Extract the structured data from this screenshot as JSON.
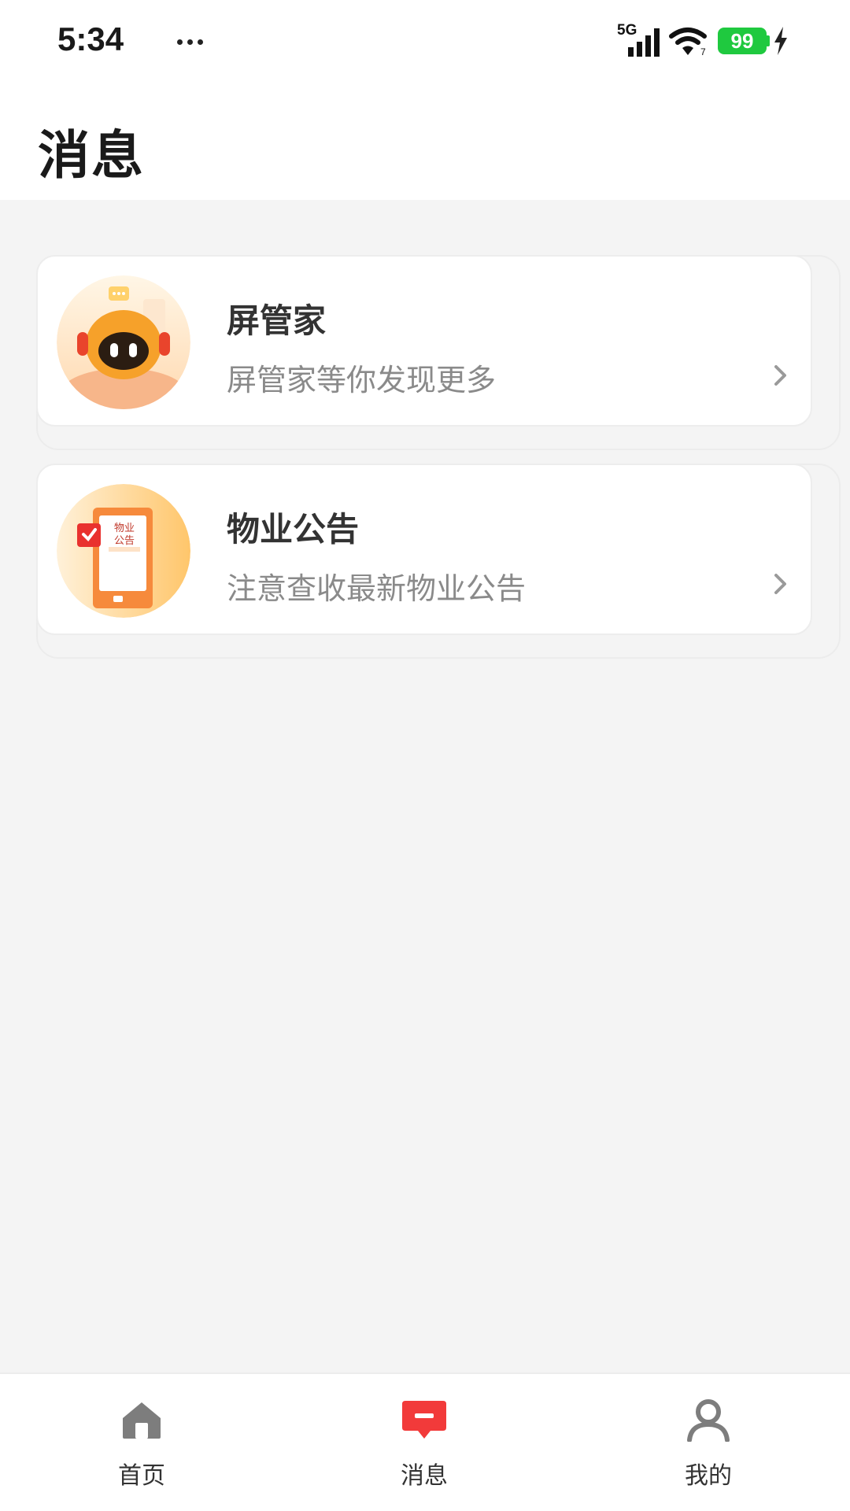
{
  "status_bar": {
    "time": "5:34",
    "network": "5G",
    "battery": "99",
    "icons": [
      "more-dots-icon",
      "signal-icon",
      "wifi-icon",
      "battery-icon",
      "charging-icon"
    ]
  },
  "header": {
    "title": "消息"
  },
  "messages": [
    {
      "title": "屏管家",
      "subtitle": "屏管家等你发现更多",
      "icon": "robot-avatar-icon"
    },
    {
      "title": "物业公告",
      "subtitle": "注意查收最新物业公告",
      "icon": "notice-avatar-icon",
      "icon_text": "物业公告"
    }
  ],
  "bottom_nav": [
    {
      "label": "首页",
      "icon": "home-icon",
      "active": false
    },
    {
      "label": "消息",
      "icon": "message-icon",
      "active": true
    },
    {
      "label": "我的",
      "icon": "profile-icon",
      "active": false
    }
  ],
  "colors": {
    "accent": "#f23a3a",
    "background": "#f4f4f4",
    "battery": "#1fc93f",
    "avatar_orange": "#f7a43c"
  }
}
